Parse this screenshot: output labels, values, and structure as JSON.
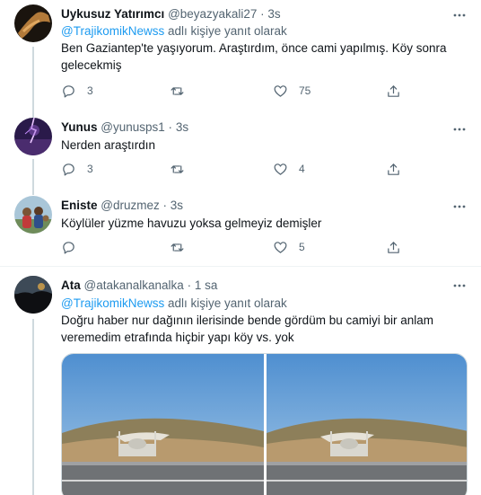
{
  "tweets": [
    {
      "name": "Uykusuz Yatırımcı",
      "handle": "@beyazyakali27",
      "dot": "·",
      "time": "3s",
      "reply_prefix": "",
      "reply_mention": "@TrajikomikNewss",
      "reply_suffix": " adlı kişiye yanıt olarak",
      "text": "Ben Gaziantep'te yaşıyorum. Araştırdım, önce cami yapılmış. Köy sonra gelecekmiş",
      "replies": "3",
      "retweets": "",
      "likes": "75"
    },
    {
      "name": "Yunus",
      "handle": "@yunusps1",
      "dot": "·",
      "time": "3s",
      "text": "Nerden araştırdın",
      "replies": "3",
      "retweets": "",
      "likes": "4"
    },
    {
      "name": "Eniste",
      "handle": "@druzmez",
      "dot": "·",
      "time": "3s",
      "text": "Köylüler yüzme havuzu yoksa gelmeyiz demişler",
      "replies": "",
      "retweets": "",
      "likes": "5"
    },
    {
      "name": "Ata",
      "handle": "@atakanalkanalka",
      "dot": "·",
      "time": "1 sa",
      "reply_mention": "@TrajikomikNewss",
      "reply_suffix": " adlı kişiye yanıt olarak",
      "text": "Doğru haber nur dağının ilerisinde bende gördüm bu camiyi bir anlam veremedim etrafında hiçbir yapı köy vs. yok"
    }
  ],
  "colors": {
    "accent": "#1d9bf0",
    "secondary_text": "#536471",
    "thread_line": "#cfd9de",
    "divider": "#eff3f4"
  },
  "icons": [
    "more-icon",
    "reply-icon",
    "retweet-icon",
    "like-icon",
    "share-icon"
  ]
}
